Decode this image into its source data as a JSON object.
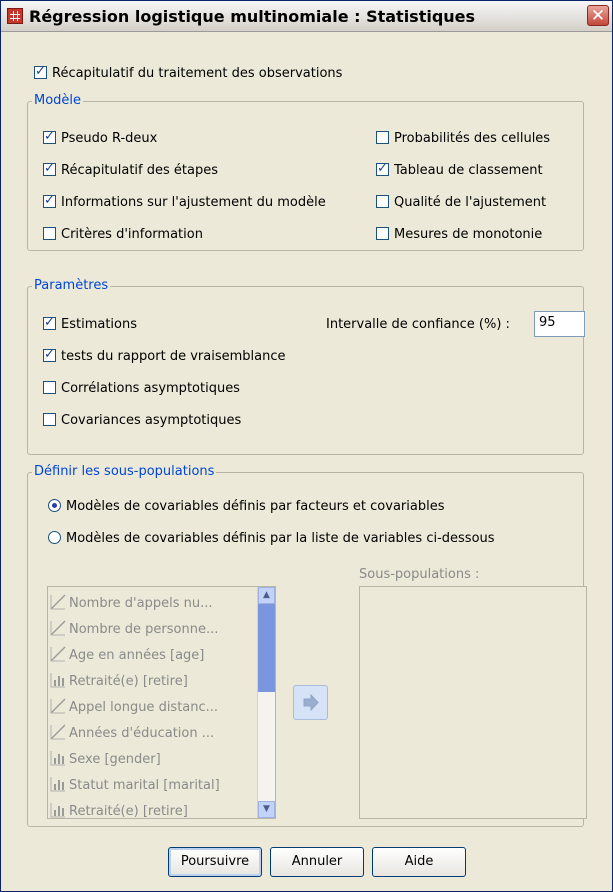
{
  "window": {
    "title": "Régression logistique multinomiale : Statistiques",
    "close_glyph": "✕",
    "app_icon": "spss-table-icon"
  },
  "top_checkbox": {
    "label": "Récapitulatif du traitement des observations",
    "checked": true
  },
  "model": {
    "title": "Modèle",
    "left": [
      {
        "label": "Pseudo R-deux",
        "checked": true
      },
      {
        "label": "Récapitulatif des étapes",
        "checked": true
      },
      {
        "label": "Informations sur l'ajustement du modèle",
        "checked": true
      },
      {
        "label": "Critères d'information",
        "checked": false
      }
    ],
    "right": [
      {
        "label": "Probabilités des cellules",
        "checked": false
      },
      {
        "label": "Tableau de classement",
        "checked": true
      },
      {
        "label": "Qualité de l'ajustement",
        "checked": false
      },
      {
        "label": "Mesures de monotonie",
        "checked": false
      }
    ]
  },
  "parameters": {
    "title": "Paramètres",
    "items": [
      {
        "label": "Estimations",
        "checked": true
      },
      {
        "label": "tests du rapport de vraisemblance",
        "checked": true
      },
      {
        "label": "Corrélations asymptotiques",
        "checked": false
      },
      {
        "label": "Covariances asymptotiques",
        "checked": false
      }
    ],
    "confidence_label": "Intervalle de confiance (%) :",
    "confidence_value": "95"
  },
  "subpops": {
    "title": "Définir les sous-populations",
    "radio1": {
      "label": "Modèles de covariables définis par facteurs et covariables",
      "checked": true
    },
    "radio2": {
      "label": "Modèles de covariables définis par la liste de variables ci-dessous",
      "checked": false
    },
    "target_label": "Sous-populations :",
    "variables": [
      {
        "label": "Nombre d'appels nu...",
        "icon": "scale-variable-icon"
      },
      {
        "label": "Nombre de personne...",
        "icon": "scale-variable-icon"
      },
      {
        "label": "Age en années [age]",
        "icon": "scale-variable-icon"
      },
      {
        "label": "Retraité(e) [retire]",
        "icon": "nominal-variable-icon"
      },
      {
        "label": "Appel longue distanc...",
        "icon": "scale-variable-icon"
      },
      {
        "label": "Années d'éducation ...",
        "icon": "scale-variable-icon"
      },
      {
        "label": "Sexe [gender]",
        "icon": "nominal-variable-icon"
      },
      {
        "label": "Statut marital [marital]",
        "icon": "nominal-variable-icon"
      },
      {
        "label": "Retraité(e) [retire]",
        "icon": "nominal-variable-icon"
      }
    ]
  },
  "buttons": {
    "continue": "Poursuivre",
    "cancel": "Annuler",
    "help": "Aide"
  }
}
